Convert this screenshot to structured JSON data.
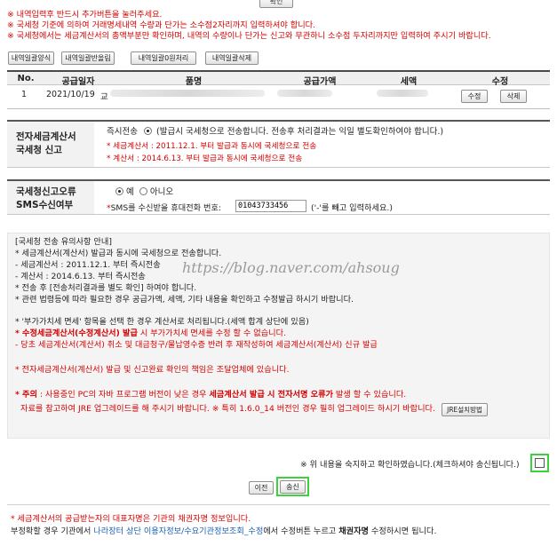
{
  "top_button": "확인",
  "notices": [
    "※ 내역입력후 반드시 추가버튼을 눌러주세요.",
    "※ 국세청 기준에 의하여 거래명세내역 수량과 단가는 소수점2자리까지 입력하셔야 합니다.",
    "※ 국세청에서는 세금계산서의 총액부분만 확인하며, 내역의 수량이나 단가는 신고와 무관하니 소수점 두자리까지만 입력하여 주시기 바랍니다."
  ],
  "toolbar": [
    "내역일괄양식",
    "내역일괄반올림",
    "내역일괄0원처리",
    "내역일괄삭제"
  ],
  "table": {
    "headers": [
      "No.",
      "공급일자",
      "품명",
      "공급가액",
      "세액",
      "수정"
    ],
    "rows": [
      {
        "no": "1",
        "date": "2021/10/19",
        "item_prefix": "교",
        "edit": "수정",
        "delete": "삭제"
      }
    ]
  },
  "nts_report": {
    "label_line1": "전자세금계산서",
    "label_line2": "국세청 신고",
    "option_label": "즉시전송",
    "option_desc": "(발급시 국세청으로 전송합니다. 전송후 처리결과는 익일 별도확인하여야 합니다.)",
    "note1": "* 세금계산서 : 2011.12.1. 부터 발급과 동시에 국세청으로 전송",
    "note2": "* 계산서 : 2014.6.13. 부터 발급과 동시에 국세청으로 전송"
  },
  "sms": {
    "label_line1": "국세청신고오류",
    "label_line2": "SMS수신여부",
    "yes": "예",
    "no": "아니오",
    "phone_label": "SMS를 수신받을 휴대전화 번호:",
    "phone_value": "01043733456",
    "hint": "('-'를 빼고 입력하세요.)"
  },
  "guide": {
    "title": "[국세청 전송 유의사항 안내]",
    "lines": [
      "* 세금계산서(계산서) 발급과 동시에 국세청으로 전송합니다.",
      "- 세금계산서 : 2011.12.1. 부터 즉시전송",
      "- 계산서 : 2014.6.13. 부터 즉시전송",
      "* 전송 후 [전송처리결과를 별도 확인] 하여야 합니다.",
      "* 관련 법령등에 따라 필요한 경우 공급가액, 세액, 기타 내용을 확인하고 수정발급 하시기 바랍니다."
    ],
    "vat_line": "* '부가가치세 면세' 항목을 선택 한 경우 계산서로 처리됩니다.(세액 합계 상단에 있음)",
    "modify_bold": "* 수정세금계산서(수정계산서) 발급",
    "modify_rest": " 시 부가가치세 면세를 수정 할 수 없습니다.",
    "cancel_line": "- 당초 세금계산서(계산서) 취소 및 대금청구/물납영수증 반려 후 재작성하여 세금계산서(계산서) 신규 발급",
    "responsibility": "* 전자세금계산서(계산서) 발급 및 신고완료 확인의 책임은 조달업체에 있습니다.",
    "caution_label": "* 주의",
    "caution_text": " : 사용중인 PC의 자바 프로그램 버전이 낮은 경우 ",
    "caution_bold": "세금계산서 발급 시 전자서명 오류가",
    "caution_end": " 발생 할 수 있습니다.",
    "jre_text": "자료를 참고하여 JRE 업그레이드를 해 주시기 바랍니다. ※ 특히 1.6.0_14 버전인 경우 필히 업그레이드 하시기 바랍니다.",
    "jre_button": "JRE설치방법"
  },
  "watermark": "https://blog.naver.com/ahsoug",
  "confirm_text": "※ 위 내용을 숙지하고 확인하였습니다.(체크하셔야 송신됩니다.)",
  "buttons": {
    "prev": "이전",
    "send": "송신"
  },
  "footer": {
    "line1": "* 세금계산서의 공급받는자의 대표자명은 기관의 채권자명 정보입니다.",
    "line2_pre": "부정확할 경우 기관에서 ",
    "line2_link": "나라장터 상단 이용자정보/수요기관정보조회_수정",
    "line2_mid": "에서 수정버튼 누르고 ",
    "line2_bold": "채권자명",
    "line2_end": " 수정하시면 됩니다."
  }
}
